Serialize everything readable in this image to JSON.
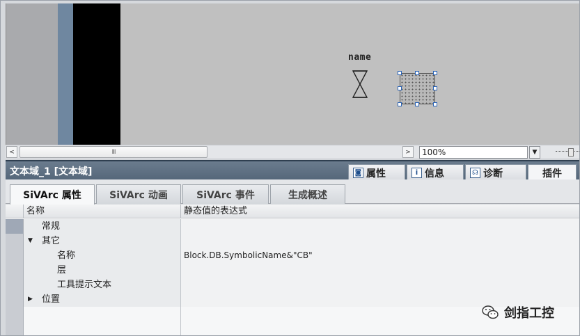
{
  "canvas": {
    "object_label": "name"
  },
  "scrollbar": {
    "left_arrow": "<",
    "right_arrow": ">",
    "thumb_grip": "III"
  },
  "zoom": {
    "value": "100%",
    "dropdown_arrow": "▼"
  },
  "inspector": {
    "title": "文本域_1 [文本域]",
    "tabs": [
      {
        "label": "属性",
        "icon": "properties-icon"
      },
      {
        "label": "信息",
        "icon": "info-icon"
      },
      {
        "label": "诊断",
        "icon": "diagnostics-icon"
      },
      {
        "label": "插件",
        "icon": ""
      }
    ]
  },
  "subtabs": [
    {
      "label": "SiVArc 属性",
      "active": true
    },
    {
      "label": "SiVArc 动画",
      "active": false
    },
    {
      "label": "SiVArc 事件",
      "active": false
    },
    {
      "label": "生成概述",
      "active": false
    }
  ],
  "grid": {
    "headers": [
      "名称",
      "静态值的表达式"
    ],
    "rows": [
      {
        "name": "常规",
        "value": "",
        "level": 1,
        "expander": ""
      },
      {
        "name": "其它",
        "value": "",
        "level": 0,
        "expander": "▼"
      },
      {
        "name": "名称",
        "value": "Block.DB.SymbolicName&\"CB\"",
        "level": 2,
        "expander": ""
      },
      {
        "name": "层",
        "value": "",
        "level": 2,
        "expander": ""
      },
      {
        "name": "工具提示文本",
        "value": "",
        "level": 2,
        "expander": ""
      },
      {
        "name": "位置",
        "value": "",
        "level": 0,
        "expander": "▶"
      }
    ]
  },
  "watermark": {
    "text": "剑指工控",
    "icon": "wechat-icon"
  }
}
